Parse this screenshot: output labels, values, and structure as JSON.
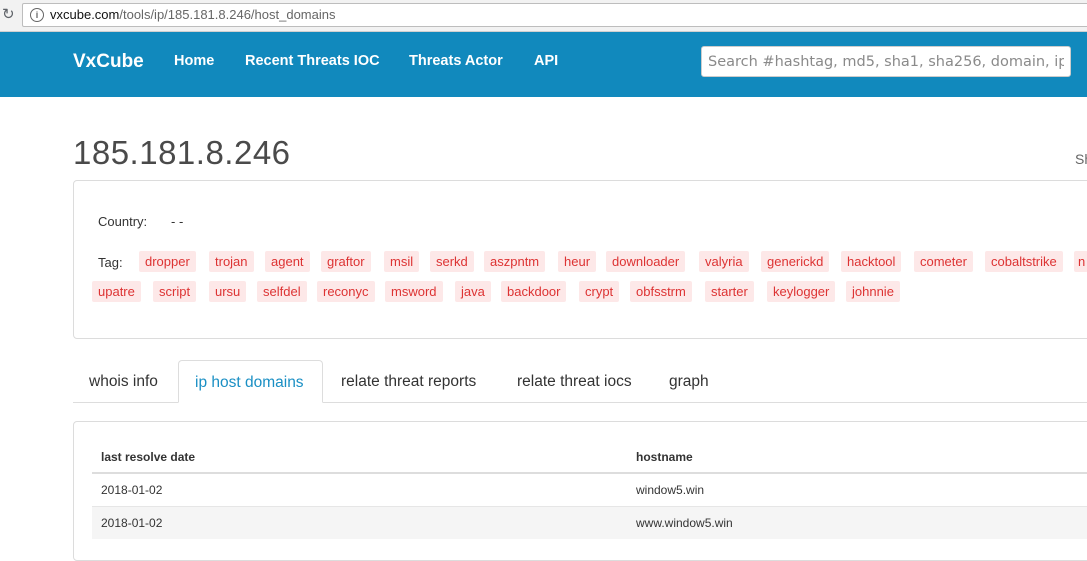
{
  "browser": {
    "url_host": "vxcube.com",
    "url_path": "/tools/ip/185.181.8.246/host_domains"
  },
  "navbar": {
    "brand": "VxCube",
    "links": [
      "Home",
      "Recent Threats IOC",
      "Threats Actor",
      "API"
    ],
    "search_placeholder": "Search #hashtag, md5, sha1, sha256, domain, ip"
  },
  "page": {
    "title": "185.181.8.246",
    "share_cut": "Sh"
  },
  "info": {
    "country_label": "Country:",
    "country_value": "- -",
    "tag_label": "Tag:",
    "tags_row1": [
      "dropper",
      "trojan",
      "agent",
      "graftor",
      "msil",
      "serkd",
      "aszpntm",
      "heur",
      "downloader",
      "valyria",
      "generickd",
      "hacktool",
      "cometer",
      "cobaltstrike",
      "n"
    ],
    "tags_row2": [
      "upatre",
      "script",
      "ursu",
      "selfdel",
      "reconyc",
      "msword",
      "java",
      "backdoor",
      "crypt",
      "obfsstrm",
      "starter",
      "keylogger",
      "johnnie"
    ]
  },
  "tabs": {
    "items": [
      "whois info",
      "ip host domains",
      "relate threat reports",
      "relate threat iocs",
      "graph"
    ],
    "active": "ip host domains"
  },
  "table": {
    "columns": [
      "last resolve date",
      "hostname"
    ],
    "rows": [
      [
        "2018-01-02",
        "window5.win"
      ],
      [
        "2018-01-02",
        "www.window5.win"
      ]
    ]
  },
  "colors": {
    "navbar": "#1189bd",
    "tag_bg": "#fde8e8",
    "tag_text": "#d33333",
    "active_tab": "#1a8fc4"
  }
}
